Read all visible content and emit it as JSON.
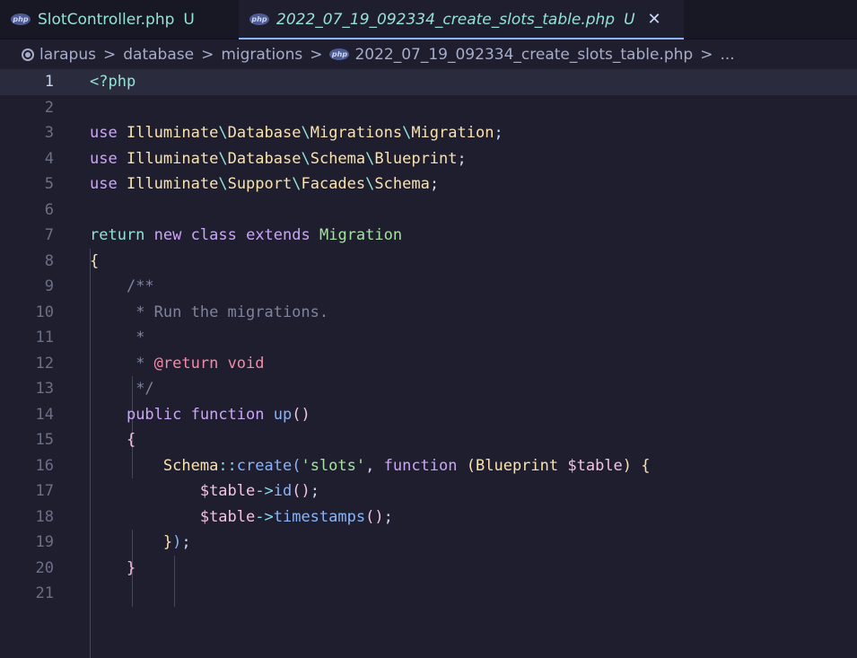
{
  "tabs": [
    {
      "label": "SlotController.php",
      "status": "U",
      "icon": "php-icon"
    },
    {
      "label": "2022_07_19_092334_create_slots_table.php",
      "status": "U",
      "icon": "php-icon",
      "close": "✕"
    }
  ],
  "breadcrumb": {
    "items": [
      "larapus",
      "database",
      "migrations",
      "2022_07_19_092334_create_slots_table.php",
      "..."
    ]
  },
  "php_badge": "php",
  "separator": ">",
  "lines": {
    "l1": "<?php",
    "use": "use",
    "ns1": "Illuminate",
    "ns2": "Database",
    "ns3": "Migrations",
    "ns4": "Migration",
    "ns5": "Schema",
    "ns6": "Blueprint",
    "ns7": "Support",
    "ns8": "Facades",
    "ret": "return",
    "new": "new",
    "class": "class",
    "extends": "extends",
    "c1": "/**",
    "c2": " * Run the migrations.",
    "c3": " *",
    "c4a": " * ",
    "c4b": "@return",
    "c4c": " void",
    "c5": " */",
    "public": "public",
    "function": "function",
    "up": "up",
    "schema": "Schema",
    "create": "create",
    "slots": "'slots'",
    "table": "$table",
    "id": "id",
    "timestamps": "timestamps",
    "arrow": "->",
    "dcolon": "::"
  },
  "line_numbers": [
    "1",
    "2",
    "3",
    "4",
    "5",
    "6",
    "7",
    "8",
    "9",
    "10",
    "11",
    "12",
    "13",
    "14",
    "15",
    "16",
    "17",
    "18",
    "19",
    "20",
    "21"
  ]
}
